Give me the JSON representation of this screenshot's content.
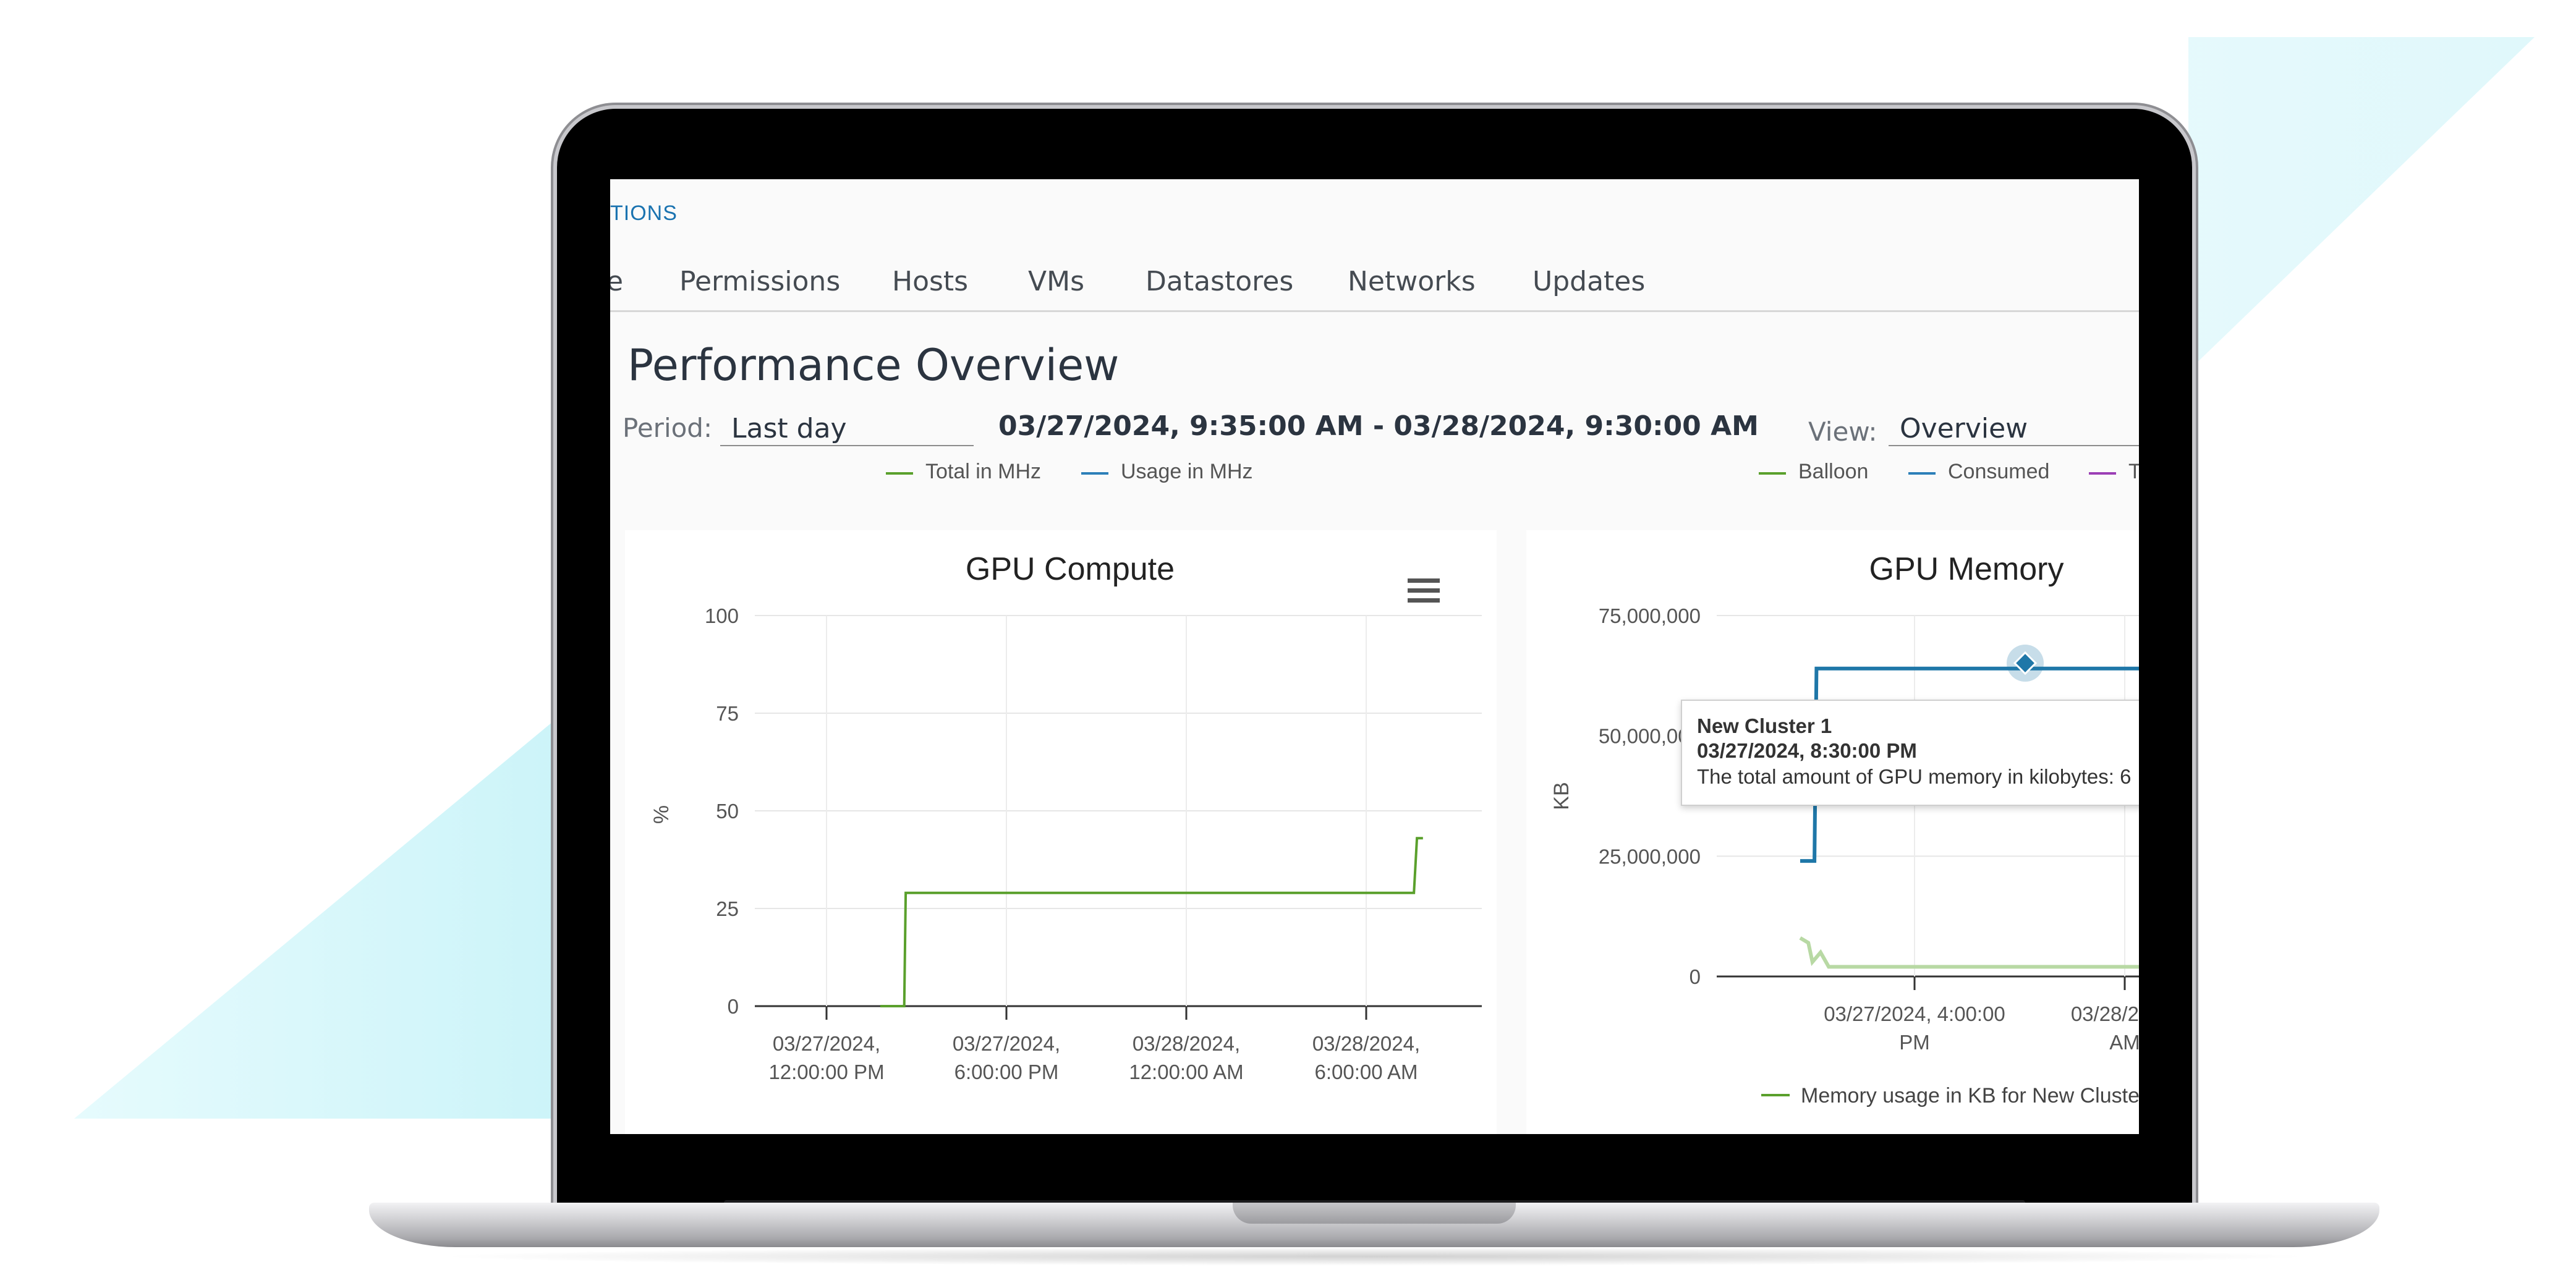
{
  "breadcrumb": "TIONS",
  "tabs": [
    {
      "label": "e"
    },
    {
      "label": "Permissions"
    },
    {
      "label": "Hosts"
    },
    {
      "label": "VMs"
    },
    {
      "label": "Datastores"
    },
    {
      "label": "Networks"
    },
    {
      "label": "Updates"
    }
  ],
  "page_title": "Performance Overview",
  "period": {
    "label": "Period:",
    "value": "Last day"
  },
  "time_range": "03/27/2024, 9:35:00 AM - 03/28/2024, 9:30:00 AM",
  "view": {
    "label": "View:",
    "value": "Overview"
  },
  "top_legend_left": [
    {
      "label": "Total in MHz",
      "color": "#5aa02c"
    },
    {
      "label": "Usage in MHz",
      "color": "#2c7fb8"
    }
  ],
  "top_legend_right": [
    {
      "label": "Balloon",
      "color": "#5aa02c"
    },
    {
      "label": "Consumed",
      "color": "#2c7fb8"
    },
    {
      "label": "T",
      "color": "#9b3fb5"
    }
  ],
  "menu_icon": "hamburger-menu-icon",
  "chart_data": [
    {
      "type": "line",
      "title": "GPU Compute",
      "ylabel": "%",
      "ylim": [
        0,
        100
      ],
      "yticks": [
        "0",
        "25",
        "50",
        "75",
        "100"
      ],
      "xticks": [
        "03/27/2024,|12:00:00 PM",
        "03/27/2024,|6:00:00 PM",
        "03/28/2024,|12:00:00 AM",
        "03/28/2024,|6:00:00 AM"
      ],
      "series": [
        {
          "color": "#5aa02c",
          "points": [
            [
              -0.6,
              0
            ],
            [
              0.2,
              0
            ],
            [
              0.25,
              29
            ],
            [
              17.2,
              29
            ],
            [
              17.3,
              43
            ],
            [
              17.5,
              43
            ]
          ]
        }
      ]
    },
    {
      "type": "line",
      "title": "GPU Memory",
      "ylabel": "KB",
      "ylim": [
        0,
        75000000
      ],
      "yticks": [
        "0",
        "25,000,000",
        "50,000,000",
        "75,000,000"
      ],
      "xticks": [
        "03/27/2024, 4:00:00|PM",
        "03/28/2024,|AM"
      ],
      "series": [
        {
          "color": "#1f77a8",
          "points": [
            [
              1.5,
              24000000
            ],
            [
              1.85,
              24000000
            ],
            [
              1.9,
              64000000
            ],
            [
              12,
              64000000
            ]
          ]
        },
        {
          "color": "#b8d9a4",
          "points": [
            [
              1.5,
              8000000
            ],
            [
              1.7,
              7000000
            ],
            [
              1.8,
              3000000
            ],
            [
              2.0,
              5000000
            ],
            [
              2.2,
              2000000
            ],
            [
              12,
              2000000
            ]
          ]
        }
      ],
      "legend": [
        {
          "label": "Memory usage in KB for New Cluste",
          "color": "#5aa02c"
        }
      ]
    }
  ],
  "tooltip": {
    "title": "New Cluster 1",
    "time": "03/27/2024, 8:30:00 PM",
    "text": "The total amount of GPU memory in kilobytes: 6"
  }
}
